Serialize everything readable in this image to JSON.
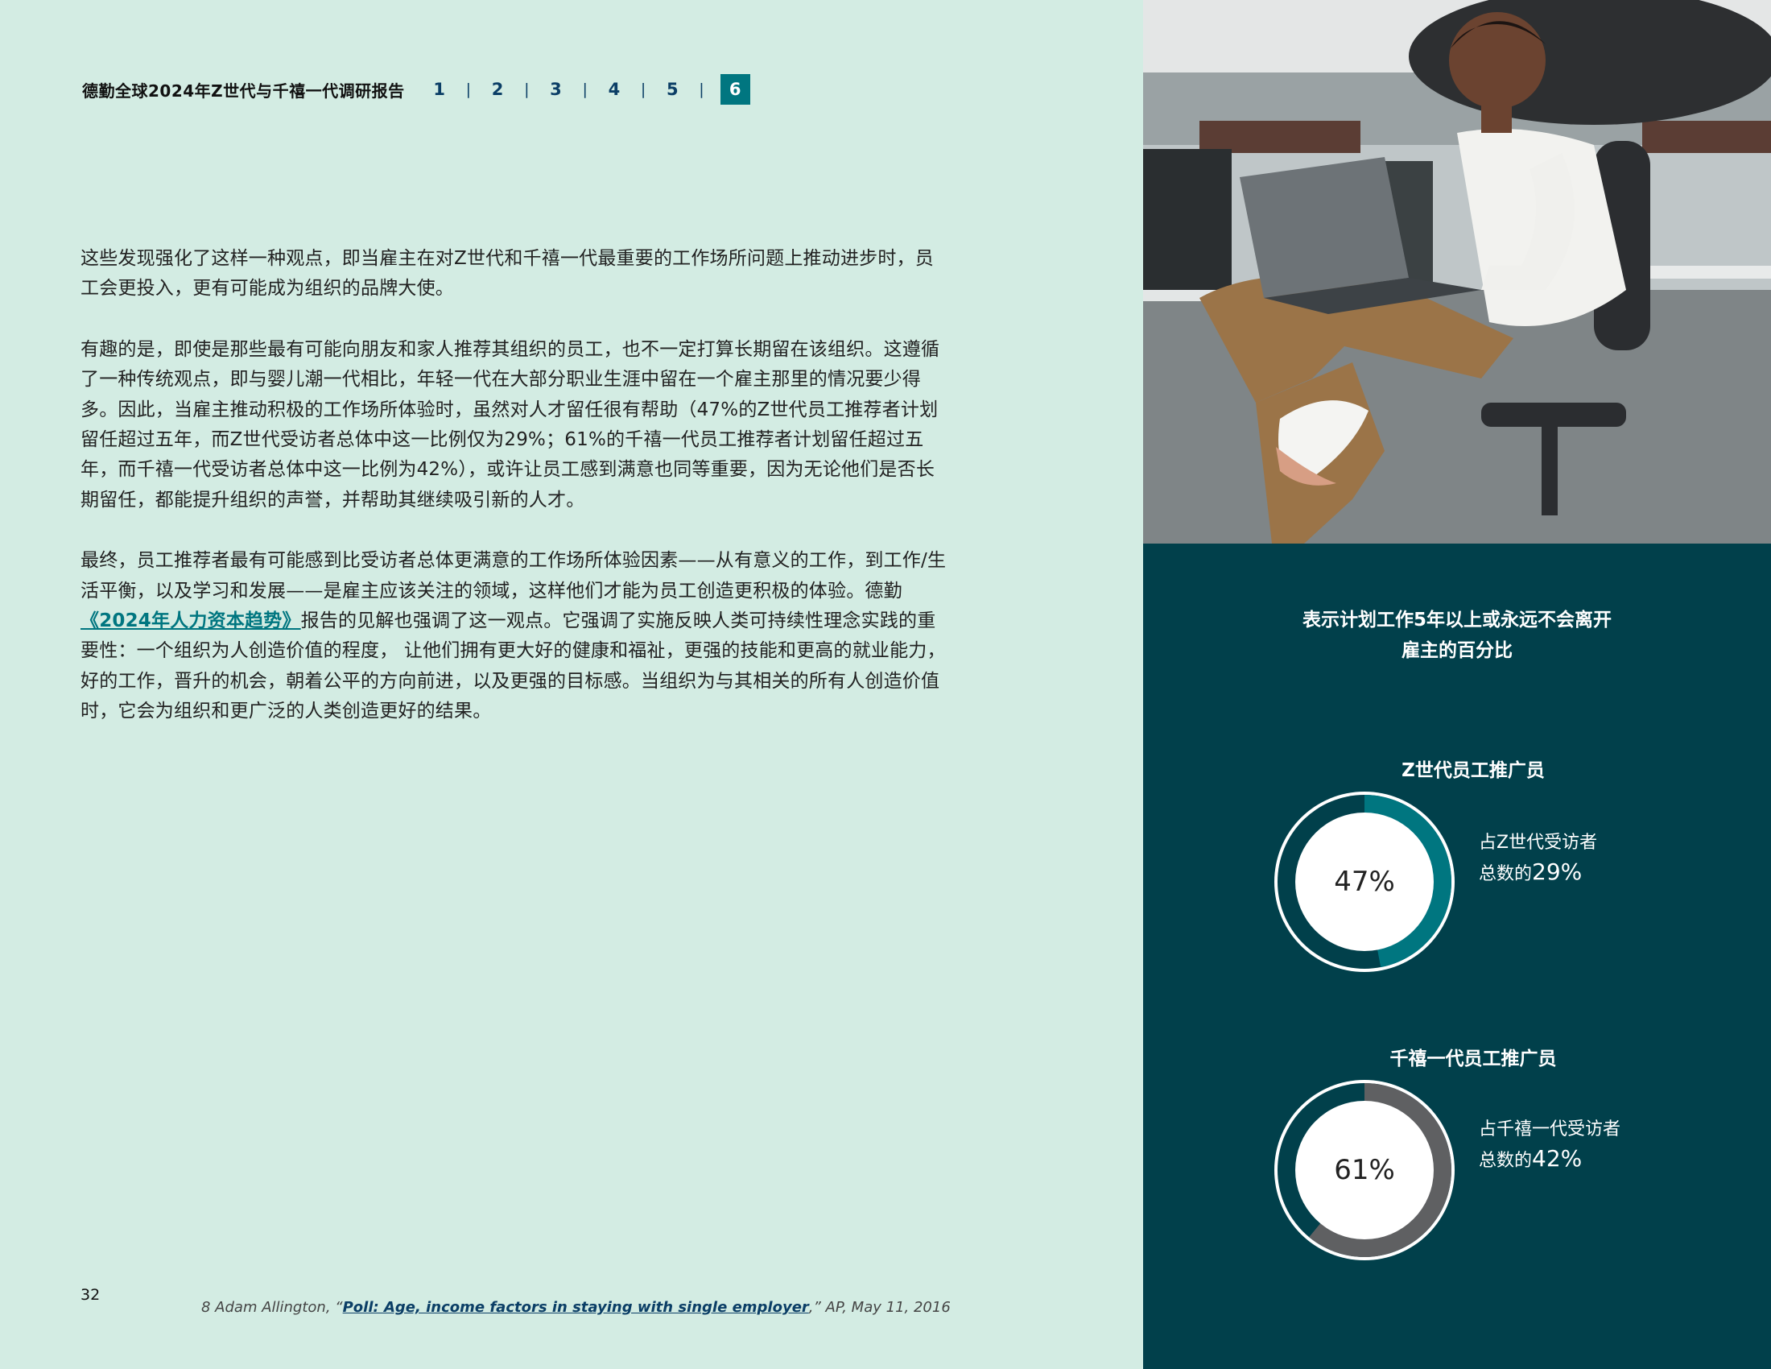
{
  "header": {
    "report_title": "德勤全球2024年Z世代与千禧一代调研报告",
    "chapters": [
      "1",
      "2",
      "3",
      "4",
      "5",
      "6"
    ],
    "active_chapter": "6",
    "active_color": "#007680"
  },
  "body": {
    "para1": "这些发现强化了这样一种观点，即当雇主在对Z世代和千禧一代最重要的工作场所问题上推动进步时，员工会更投入，更有可能成为组织的品牌大使。",
    "para2": "有趣的是，即使是那些最有可能向朋友和家人推荐其组织的员工，也不一定打算长期留在该组织。这遵循了一种传统观点，即与婴儿潮一代相比，年轻一代在大部分职业生涯中留在一个雇主那里的情况要少得多。因此，当雇主推动积极的工作场所体验时，虽然对人才留任很有帮助（47%的Z世代员工推荐者计划留任超过五年，而Z世代受访者总体中这一比例仅为29%；61%的千禧一代员工推荐者计划留任超过五年，而千禧一代受访者总体中这一比例为42%），或许让员工感到满意也同等重要，因为无论他们是否长期留任，都能提升组织的声誉，并帮助其继续吸引新的人才。",
    "para3_before": "最终，员工推荐者最有可能感到比受访者总体更满意的工作场所体验因素——从有意义的工作，到工作/生活平衡，以及学习和发展——是雇主应该关注的领域，这样他们才能为员工创造更积极的体验。德勤",
    "para3_link": "《2024年人力资本趋势》",
    "para3_after": "报告的见解也强调了这一观点。它强调了实施反映人类可持续性理念实践的重要性：一个组织为人创造价值的程度， 让他们拥有更大好的健康和福祉，更强的技能和更高的就业能力，好的工作，晋升的机会，朝着公平的方向前进，以及更强的目标感。当组织为与其相关的所有人创造价值时，它会为组织和更广泛的人类创造更好的结果。"
  },
  "footer": {
    "page_number": "32",
    "footnote_prefix": "8 Adam Allington, “",
    "footnote_link": "Poll: Age, income factors in staying with single employer",
    "footnote_suffix": ",” AP, May 11, 2016"
  },
  "stats": {
    "title_line1": "表示计划工作5年以上或永远不会离开",
    "title_line2": "雇主的百分比",
    "background": "#01404b",
    "items": [
      {
        "label": "Z世代员工推广员",
        "value_text": "47%",
        "percent": 47,
        "ring_color": "#007680",
        "caption_line1": "占Z世代受访者",
        "caption_prefix": "总数的",
        "caption_value": "29%"
      },
      {
        "label": "千禧一代员工推广员",
        "value_text": "61%",
        "percent": 61,
        "ring_color": "#5f6062",
        "caption_line1": "占千禧一代受访者",
        "caption_prefix": "总数的",
        "caption_value": "42%"
      }
    ]
  },
  "photo": {
    "description_icon": "photo-person-laptop"
  }
}
